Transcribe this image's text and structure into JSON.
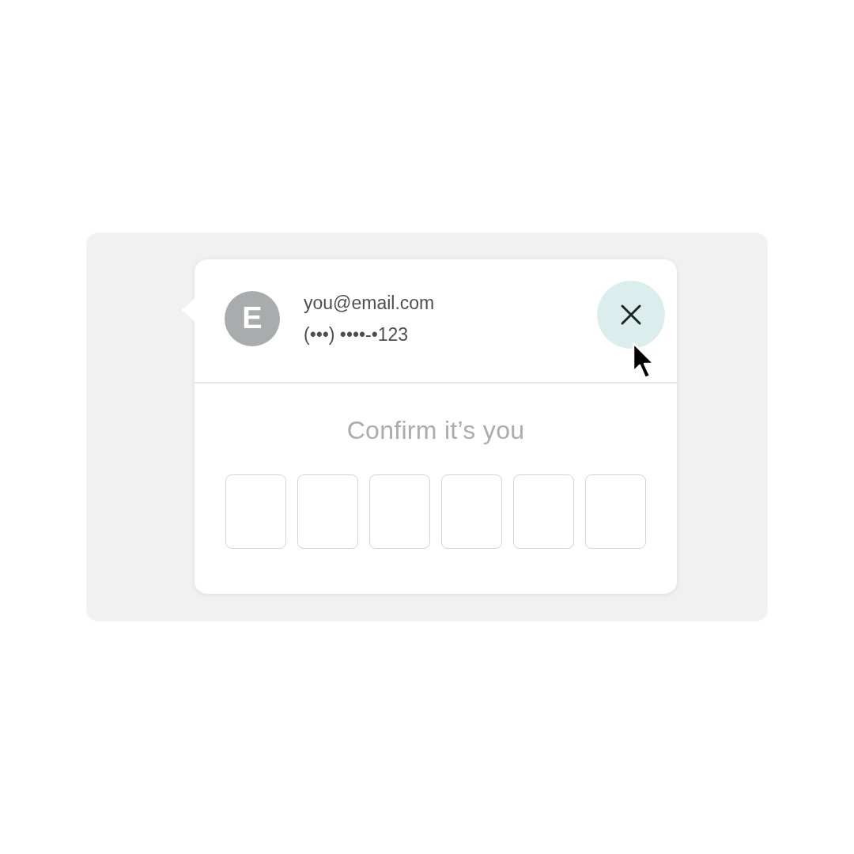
{
  "account": {
    "avatar_initial": "E",
    "email": "you@email.com",
    "phone": "(•••) ••••-•123"
  },
  "close_button": {
    "hovered": true
  },
  "verification": {
    "title": "Confirm it’s you",
    "code_boxes": [
      {
        "kind": "digit"
      },
      {
        "kind": "digit"
      },
      {
        "kind": "digit"
      },
      {
        "kind": "digit"
      },
      {
        "kind": "digit"
      },
      {
        "kind": "digit"
      }
    ]
  }
}
